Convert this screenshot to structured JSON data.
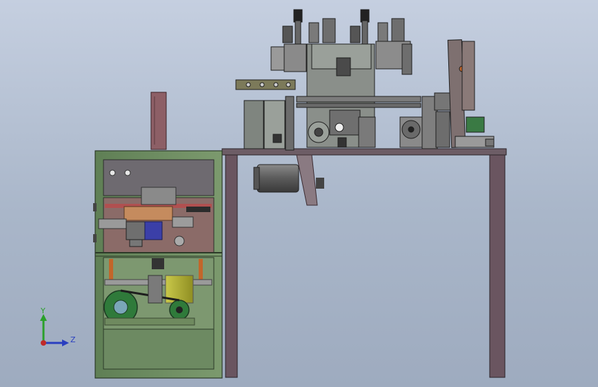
{
  "viewport": {
    "background_top": "#c5cfe0",
    "background_bottom": "#9eabbf",
    "frame_color": "#5a4a52",
    "cabinet_color": "#6f8f63",
    "panel_color": "#7a5a5a",
    "motor_color": "#6b6b6b",
    "drive_color": "#2f7a3a",
    "gearbox_color": "#b8b83a",
    "roller_color": "#c2662a",
    "cylinder_color": "#3b3fa8"
  },
  "triad": {
    "y_label": "Y",
    "z_label": "Z",
    "y_color": "#2aa02a",
    "z_color": "#2a3fc0",
    "x_color": "#c02a2a"
  }
}
